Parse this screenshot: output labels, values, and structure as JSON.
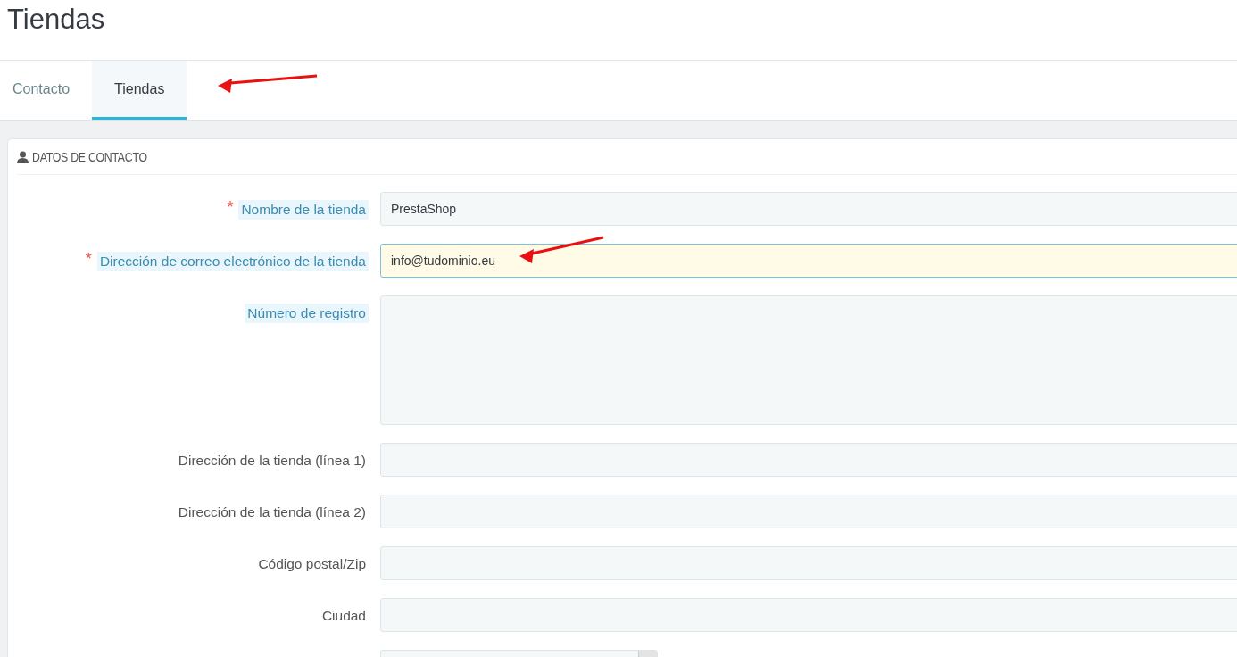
{
  "page_title": "Tiendas",
  "tabs": [
    {
      "label": "Contacto",
      "selected": false
    },
    {
      "label": "Tiendas",
      "selected": true
    }
  ],
  "panel": {
    "title": "DATOS DE CONTACTO",
    "fields": [
      {
        "kind": "input",
        "required_mark": "*",
        "label": "Nombre de la tienda",
        "hint": true,
        "value": "PrestaShop",
        "focused": false
      },
      {
        "kind": "input",
        "required_mark": "*",
        "label": "Dirección de correo electrónico de la tienda",
        "hint": true,
        "value": "info@tudominio.eu",
        "focused": true
      },
      {
        "kind": "textarea",
        "label": "Número de registro",
        "hint": true
      },
      {
        "kind": "input",
        "label": "Dirección de la tienda (línea 1)",
        "hint": false,
        "focused": false
      },
      {
        "kind": "input",
        "label": "Dirección de la tienda (línea 2)",
        "hint": false,
        "focused": false
      },
      {
        "kind": "input",
        "label": "Código postal/Zip",
        "hint": false,
        "focused": false
      },
      {
        "kind": "input",
        "label": "Ciudad",
        "hint": false,
        "focused": false
      },
      {
        "kind": "select"
      }
    ]
  }
}
